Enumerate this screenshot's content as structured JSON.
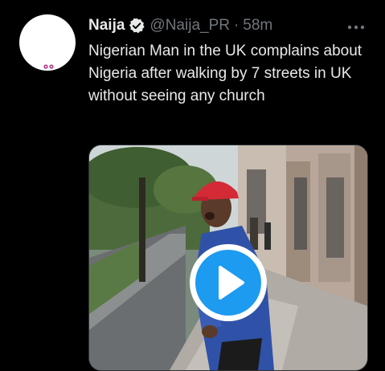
{
  "tweet": {
    "author_name": "Naija",
    "author_handle": "@Naija_PR",
    "separator": "·",
    "time": "58m",
    "text": "Nigerian Man in the UK complains about Nigeria after walking by 7 streets in UK without seeing any church",
    "verified": true
  },
  "icons": {
    "verified": "verified-badge-icon",
    "more": "more-options-icon",
    "play": "play-icon"
  },
  "colors": {
    "background": "#000000",
    "primary_text": "#e7e9ea",
    "secondary_text": "#71767b",
    "accent": "#1d9bf0"
  }
}
